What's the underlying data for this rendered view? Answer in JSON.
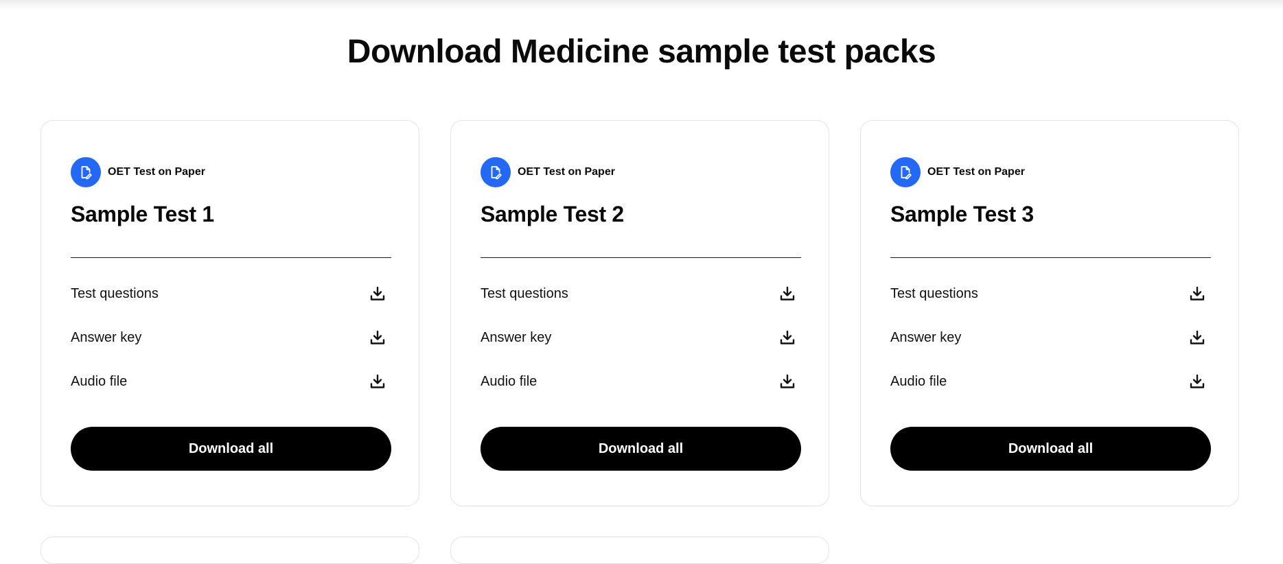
{
  "page": {
    "title": "Download Medicine sample test packs"
  },
  "colors": {
    "badge_blue": "#2469f5",
    "button_black": "#000000"
  },
  "cards": [
    {
      "badge_icon": "paper-edit-icon",
      "badge_label": "OET Test on Paper",
      "title": "Sample Test 1",
      "files": [
        "Test questions",
        "Answer key",
        "Audio file"
      ],
      "download_icon": "download-icon",
      "download_all_label": "Download all"
    },
    {
      "badge_icon": "paper-edit-icon",
      "badge_label": "OET Test on Paper",
      "title": "Sample Test 2",
      "files": [
        "Test questions",
        "Answer key",
        "Audio file"
      ],
      "download_icon": "download-icon",
      "download_all_label": "Download all"
    },
    {
      "badge_icon": "paper-edit-icon",
      "badge_label": "OET Test on Paper",
      "title": "Sample Test 3",
      "files": [
        "Test questions",
        "Answer key",
        "Audio file"
      ],
      "download_icon": "download-icon",
      "download_all_label": "Download all"
    }
  ]
}
